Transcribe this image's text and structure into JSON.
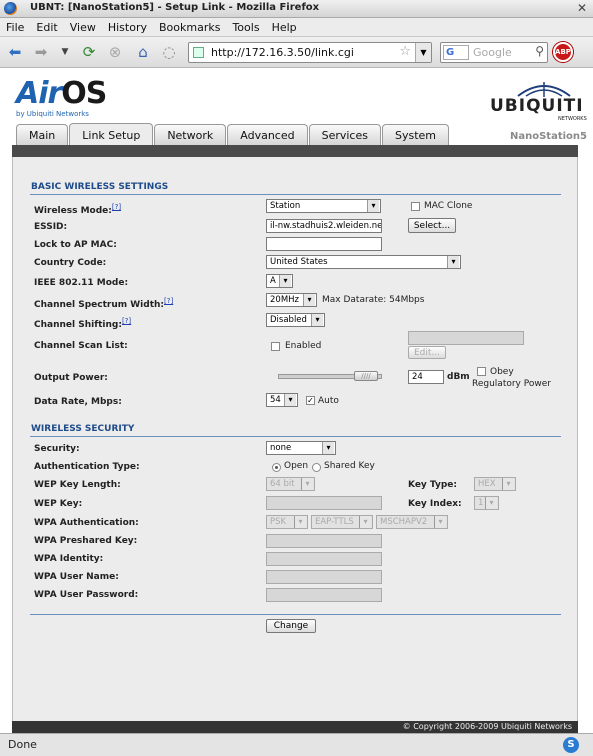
{
  "window": {
    "title": "UBNT: [NanoStation5] - Setup Link - Mozilla Firefox",
    "close": "✕"
  },
  "menu": [
    "File",
    "Edit",
    "View",
    "History",
    "Bookmarks",
    "Tools",
    "Help"
  ],
  "toolbar": {
    "url": "http://172.16.3.50/link.cgi",
    "search_placeholder": "Google",
    "search_engine": "G",
    "adblock": "ABP"
  },
  "brand": {
    "logo_air": "Air",
    "logo_os": "OS",
    "logo_sub": "by Ubiquiti Networks",
    "vendor": "UBIQUITI",
    "vendor_sub": "NETWORKS",
    "model": "NanoStation5"
  },
  "tabs": [
    "Main",
    "Link Setup",
    "Network",
    "Advanced",
    "Services",
    "System"
  ],
  "active_tab": "Link Setup",
  "basic": {
    "title": "BASIC WIRELESS SETTINGS",
    "wireless_mode": {
      "label": "Wireless Mode:",
      "help": "[?]",
      "value": "Station"
    },
    "mac_clone": {
      "label": "MAC Clone",
      "checked": false
    },
    "essid": {
      "label": "ESSID:",
      "value": "il-nw.stadhuis2.wleiden.ne",
      "select_btn": "Select..."
    },
    "lock_ap": {
      "label": "Lock to AP MAC:",
      "value": ""
    },
    "country": {
      "label": "Country Code:",
      "value": "United States"
    },
    "ieee": {
      "label": "IEEE 802.11 Mode:",
      "value": "A"
    },
    "spectrum": {
      "label": "Channel Spectrum Width:",
      "help": "[?]",
      "value": "20MHz",
      "note": "Max Datarate: 54Mbps"
    },
    "shifting": {
      "label": "Channel Shifting:",
      "help": "[?]",
      "value": "Disabled"
    },
    "scan": {
      "label": "Channel Scan List:",
      "enabled_label": "Enabled",
      "edit_btn": "Edit..."
    },
    "power": {
      "label": "Output Power:",
      "value": "24",
      "unit": "dBm",
      "obey": "Obey",
      "regulatory": "Regulatory Power",
      "slider_fraction": 0.95
    },
    "rate": {
      "label": "Data Rate, Mbps:",
      "value": "54",
      "auto_label": "Auto",
      "auto_checked": true
    }
  },
  "security": {
    "title": "WIRELESS SECURITY",
    "security": {
      "label": "Security:",
      "value": "none"
    },
    "auth": {
      "label": "Authentication Type:",
      "open": "Open",
      "shared": "Shared Key",
      "selected": "Open"
    },
    "wep_len": {
      "label": "WEP Key Length:",
      "value": "64 bit"
    },
    "key_type": {
      "label": "Key Type:",
      "value": "HEX"
    },
    "wep_key": {
      "label": "WEP Key:",
      "value": ""
    },
    "key_index": {
      "label": "Key Index:",
      "value": "1"
    },
    "wpa_auth": {
      "label": "WPA Authentication:",
      "v1": "PSK",
      "v2": "EAP-TTLS",
      "v3": "MSCHAPV2"
    },
    "wpa_psk": {
      "label": "WPA Preshared Key:"
    },
    "wpa_identity": {
      "label": "WPA Identity:"
    },
    "wpa_user": {
      "label": "WPA User Name:"
    },
    "wpa_pass": {
      "label": "WPA User Password:"
    }
  },
  "change_btn": "Change",
  "footer": "© Copyright 2006-2009 Ubiquiti Networks",
  "status": "Done",
  "status_icon": "S"
}
